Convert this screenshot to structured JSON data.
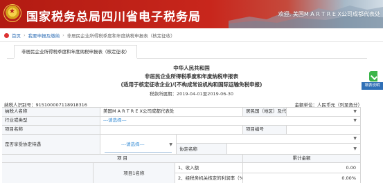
{
  "header": {
    "site_title": "国家税务总局四川省电子税务局",
    "welcome": "欢迎, 美国M A R T R E X公司成都代表处"
  },
  "breadcrumb": {
    "home": "首页",
    "level1": "我要申报及缴纳",
    "level2": "非居民企业所得税季度和年度纳税申报表（核定征收）"
  },
  "tab": {
    "label": "非居民企业所得税季度和年度纳税申报表（核定征收）"
  },
  "form_title": {
    "line1": "中华人民共和国",
    "line2": "非居民企业所得税季度和年度纳税申报表",
    "line3": "(适用于核定征收企业)/(不构成常设机构和国际运输免税申报)",
    "period": "税款所属期：2019-04-01至2019-06-30"
  },
  "taxpayer_id": "纳税人识别号：915100007118918316",
  "amount_unit": "金额单位：人民币元（列至角分）",
  "form": {
    "taxpayer_name_label": "纳税人名称",
    "taxpayer_name_value": "美国M A R T R E X公司成都代表处",
    "residence_label": "居民国（地区）及代码",
    "industry_label": "行业或类型",
    "industry_select": "---请选择---",
    "project_name_label": "项目名称",
    "project_no_label": "项目编号",
    "treaty_label": "是否享受协定待遇",
    "treaty_select": "---请选择---",
    "treaty_name_label": "协定名称",
    "col_item": "项 目",
    "col_amount": "累计金额",
    "project1_label": "项目1名称",
    "row1_label": "1、收入额",
    "row1_value": "0.00",
    "row2_label": "2、经税务机关核定的利润率（%）",
    "row2_value": "0.00%"
  },
  "side": {
    "button_label": "填表说明"
  },
  "colors": {
    "header_red": "#c8261c",
    "link_blue": "#2f6fb6",
    "side_green": "#3bb54a"
  }
}
